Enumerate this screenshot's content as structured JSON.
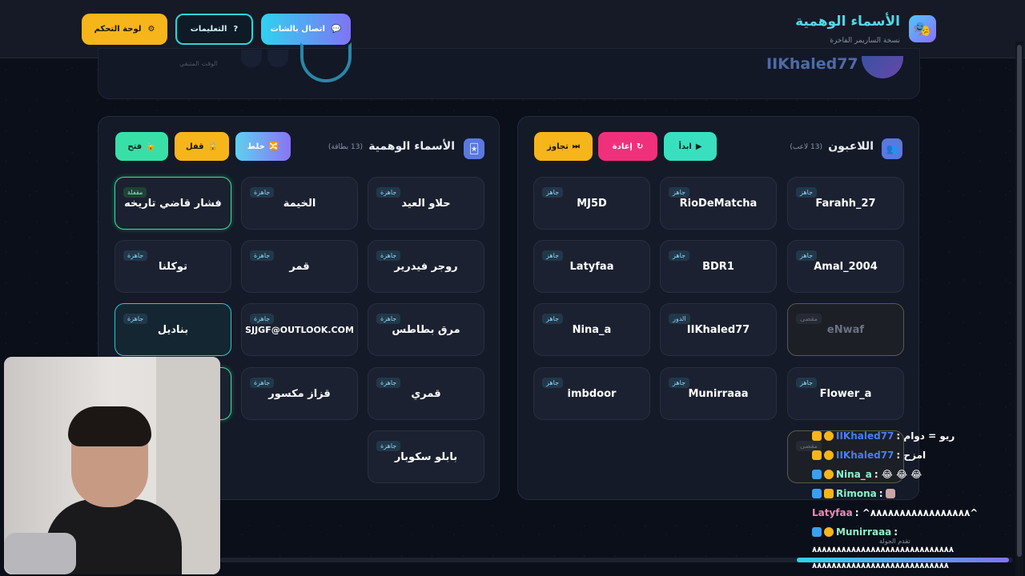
{
  "header": {
    "title": "الأسماء الوهمية",
    "subtitle": "نسخة الساريمر الفاخرة",
    "buttons": {
      "dashboard": "لوحة التحكم",
      "instructions": "التعليمات",
      "chat": "اتصال بالشات"
    }
  },
  "top_panel": {
    "player_name": "IIKhaled77",
    "time_label": "الوقت المتبقي"
  },
  "names_panel": {
    "title": "الأسماء الوهمية",
    "count": "(13 بطاقة)",
    "buttons": {
      "shuffle": "خلط",
      "lock": "قفل",
      "open": "فتح"
    },
    "cards": [
      {
        "text": "حلاو العيد",
        "tag": "جاهزة"
      },
      {
        "text": "الخيمة",
        "tag": "جاهزة"
      },
      {
        "text": "فشار قاضي تاريخه",
        "tag": "مقفلة"
      },
      {
        "text": "روجر فيدرير",
        "tag": "جاهزة"
      },
      {
        "text": "قمر",
        "tag": "جاهزة"
      },
      {
        "text": "توكلنا",
        "tag": "جاهزة"
      },
      {
        "text": "مرق بطاطس",
        "tag": "جاهزة"
      },
      {
        "text": "SJJGF@OUTLOOK.COM",
        "tag": "جاهزة"
      },
      {
        "text": "بناديل",
        "tag": "جاهزة"
      },
      {
        "text": "قمري",
        "tag": "جاهزة"
      },
      {
        "text": "قزاز مكسور",
        "tag": "جاهزة"
      },
      {
        "text": "بابلو سكوبار",
        "tag": "جاهزة"
      }
    ]
  },
  "players_panel": {
    "title": "اللاعبون",
    "count": "(13 لاعب)",
    "buttons": {
      "start": "ابدأ",
      "reset": "إعادة",
      "skip": "تجاوز"
    },
    "cards": [
      {
        "text": "Farahh_27",
        "tag": "جاهز"
      },
      {
        "text": "RioDeMatcha",
        "tag": "جاهز"
      },
      {
        "text": "MJ5D",
        "tag": "جاهز"
      },
      {
        "text": "Amal_2004",
        "tag": "جاهز"
      },
      {
        "text": "BDR1",
        "tag": "جاهز"
      },
      {
        "text": "Latyfaa",
        "tag": "جاهز"
      },
      {
        "text": "eNwaf",
        "tag": "مقصى"
      },
      {
        "text": "IIKhaled77",
        "tag": "الدور"
      },
      {
        "text": "Nina_a",
        "tag": "جاهز"
      },
      {
        "text": "Flower_a",
        "tag": "جاهز"
      },
      {
        "text": "Munirraaa",
        "tag": "جاهز"
      },
      {
        "text": "imbdoor",
        "tag": "جاهز"
      },
      {
        "text": "",
        "tag": "مقصى"
      }
    ]
  },
  "chat": [
    {
      "user": "IIKhaled77",
      "message": " : ريو = دوام",
      "color": "#4a7cf2"
    },
    {
      "user": "IIKhaled77",
      "message": " : امزح",
      "color": "#4a7cf2"
    },
    {
      "user": "Nina_a",
      "message": " : 😂 😂 😂",
      "color": "#8ef0c8"
    },
    {
      "user": "Rimona",
      "message": " : ",
      "color": "#8ef0c8"
    },
    {
      "user": "Latyfaa",
      "message": " : ^٨٨٨٨٨٨٨٨٨٨٨٨٨٨٨٨٨^",
      "color": "#f08ab8"
    },
    {
      "user": "Munirraaa",
      "message": " : ",
      "color": "#8ef0c8"
    },
    {
      "user": "",
      "message": "٨٨٨٨٨٨٨٨٨٨٨٨٨٨٨٨٨٨٨٨٨٨٨٨٨٨٨٨٨",
      "color": "#ffffff"
    },
    {
      "user": "",
      "message": "٨٨٨٨٨٨٨٨٨٨٨٨٨٨٨٨٨٨٨٨٨٨٨٨٨٨٨٨",
      "color": "#ffffff"
    }
  ],
  "chat_overlay_note": "تقدم الجولة",
  "icons": {
    "logo": "mask-icon",
    "players": "players-icon",
    "names": "card-icon"
  }
}
